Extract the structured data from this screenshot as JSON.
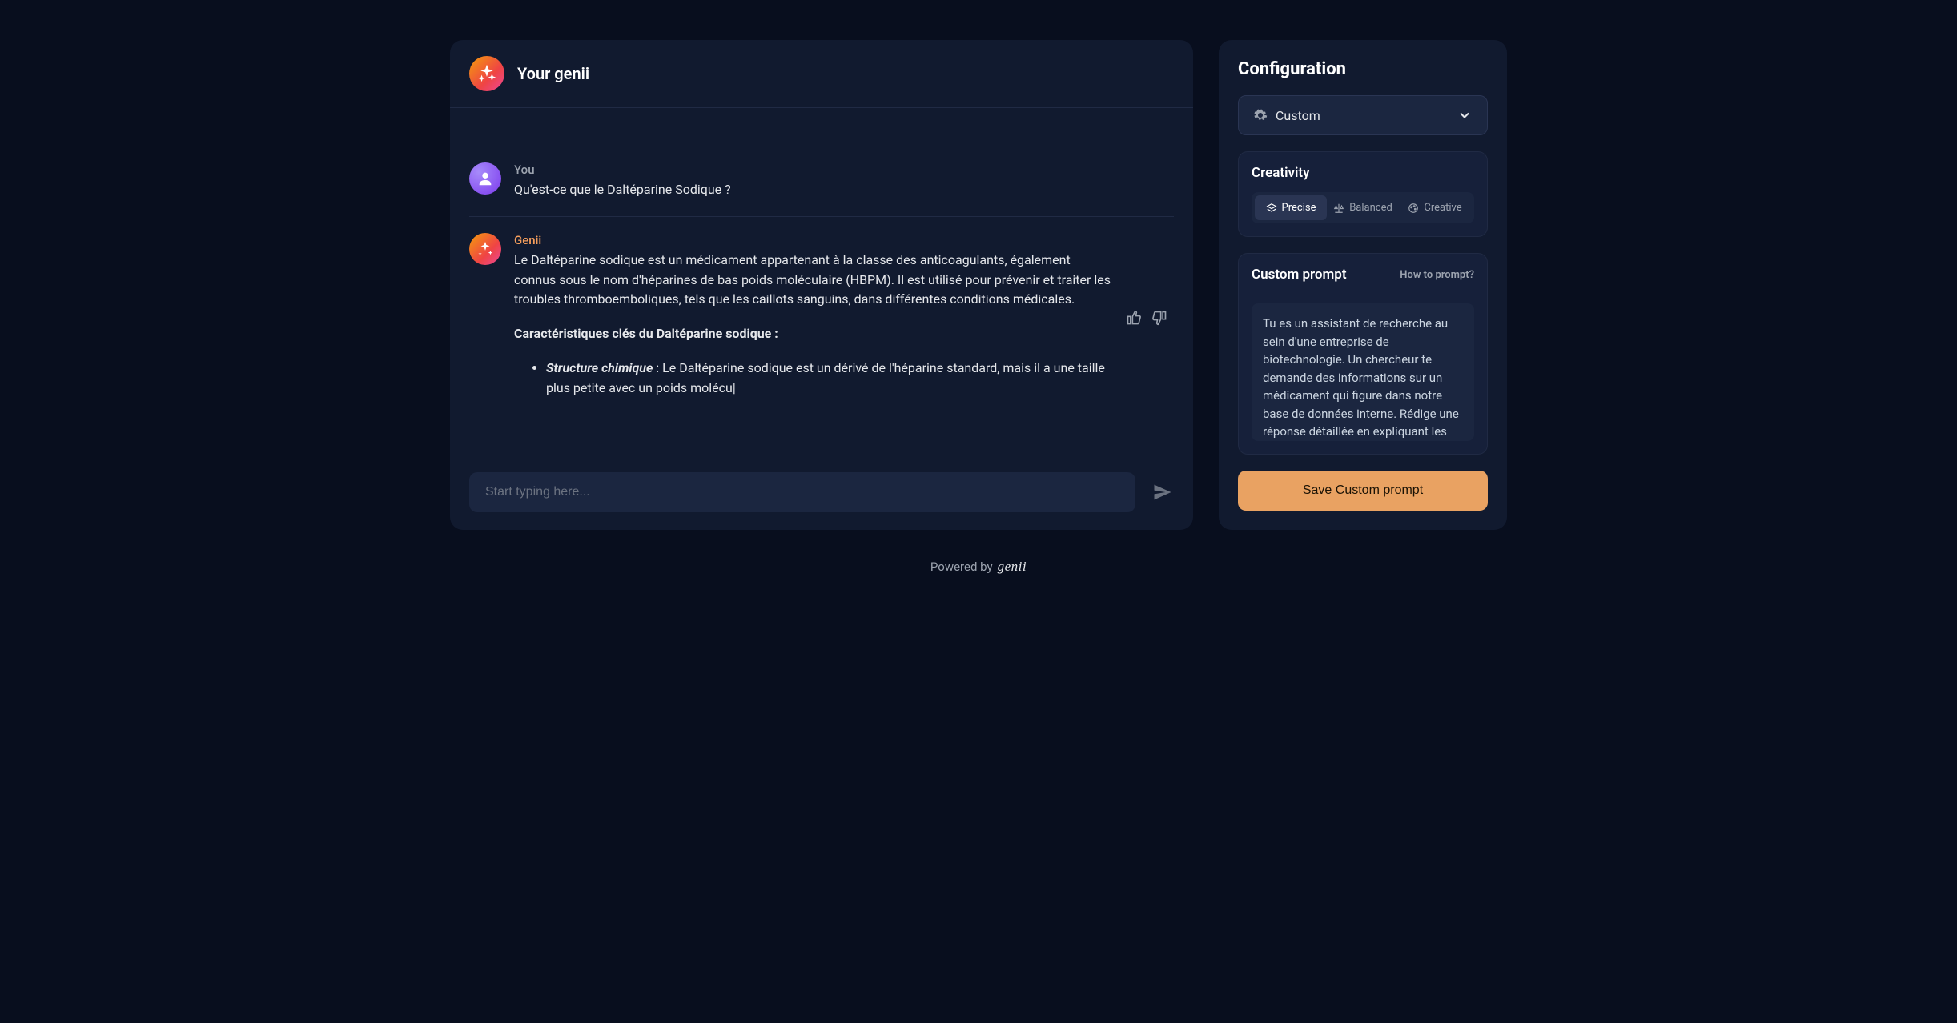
{
  "chat": {
    "title": "Your genii",
    "user_label": "You",
    "user_message": "Qu'est-ce que le Daltéparine Sodique ?",
    "assistant_label": "Genii",
    "assistant_paragraph": "Le Daltéparine sodique est un médicament appartenant à la classe des anticoagulants, également connus sous le nom d'héparines de bas poids moléculaire (HBPM). Il est utilisé pour prévenir et traiter les troubles thromboemboliques, tels que les caillots sanguins, dans différentes conditions médicales.",
    "assistant_subheading": "Caractéristiques clés du Daltéparine sodique :",
    "bullet_label": "Structure chimique",
    "bullet_text": " : Le Daltéparine sodique est un dérivé de l'héparine standard, mais il a une taille plus petite avec un poids molécu",
    "input_placeholder": "Start typing here..."
  },
  "config": {
    "title": "Configuration",
    "preset_value": "Custom",
    "creativity_label": "Creativity",
    "creativity_options": {
      "precise": "Precise",
      "balanced": "Balanced",
      "creative": "Creative"
    },
    "custom_prompt_label": "Custom prompt",
    "how_to_link": "How to prompt?",
    "custom_prompt_value": "Tu es un assistant de recherche au sein d'une entreprise de biotechnologie. Un chercheur te demande des informations sur un médicament qui figure dans notre base de données interne. Rédige une réponse détaillée en expliquant les caractéristiques",
    "save_label": "Save Custom prompt"
  },
  "footer": {
    "powered_by": "Powered by",
    "brand": "genii"
  }
}
